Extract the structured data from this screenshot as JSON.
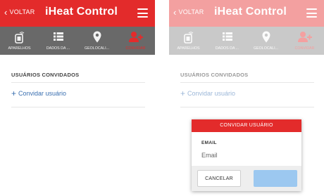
{
  "header": {
    "back_label": "VOLTAR",
    "title": "iHeat Control"
  },
  "nav": {
    "items": [
      {
        "label": "APARELHOS",
        "icon": "device-icon"
      },
      {
        "label": "DADOS DA ...",
        "icon": "list-icon"
      },
      {
        "label": "GEOLOCALI...",
        "icon": "location-pin-icon"
      },
      {
        "label": "CONVIDAR",
        "icon": "add-user-icon"
      }
    ],
    "active": 3
  },
  "content": {
    "section_title": "USUÁRIOS CONVIDADOS",
    "invite_label": "Convidar usuário"
  },
  "modal": {
    "title": "CONVIDAR USUÁRIO",
    "email_label": "EMAIL",
    "email_placeholder": "Email",
    "email_value": "",
    "cancel_label": "CANCELAR"
  },
  "colors": {
    "accent": "#e32b2b",
    "nav_bg": "#696969",
    "link": "#3a6fb0",
    "send_button": "#9cc8f0"
  }
}
